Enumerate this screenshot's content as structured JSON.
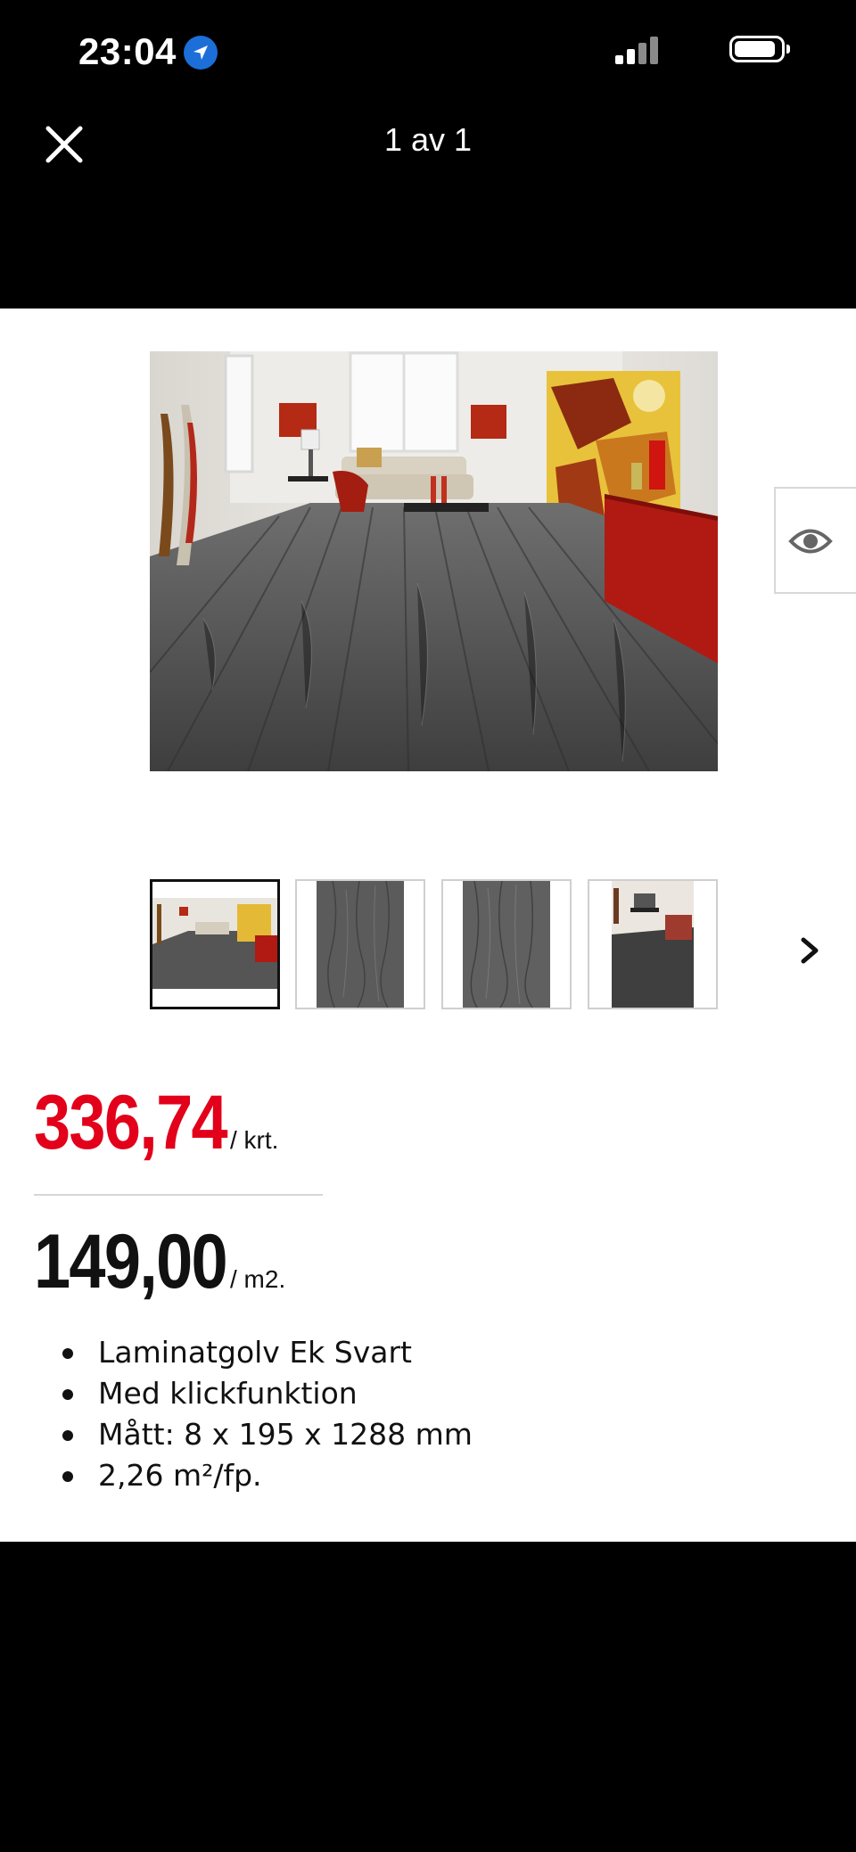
{
  "status_bar": {
    "time": "23:04",
    "icons": [
      "location-icon",
      "signal-icon",
      "battery-icon"
    ]
  },
  "viewer": {
    "close_icon": "close-icon",
    "counter": "1 av 1"
  },
  "product": {
    "price_old": "336,74",
    "price_old_unit": "/ krt.",
    "price_new": "149,00",
    "price_new_unit": "/ m2.",
    "features": [
      "Laminatgolv Ek Svart",
      "Med klickfunktion",
      "Mått: 8 x 195 x 1288 mm",
      "2,26 m²/fp."
    ]
  },
  "gallery": {
    "thumbnail_count": 4,
    "selected_thumbnail": 1,
    "view_icon": "eye-icon",
    "next_icon": "chevron-right-icon"
  },
  "colors": {
    "price_old": "#e2001a",
    "price_new": "#111111",
    "background": "#000000",
    "card": "#ffffff"
  }
}
